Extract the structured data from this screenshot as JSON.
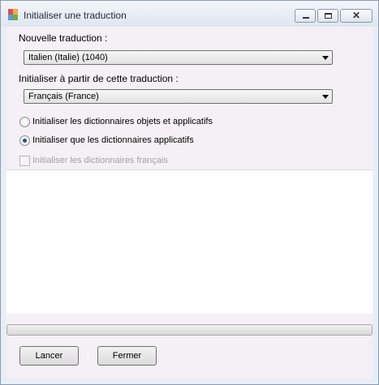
{
  "window": {
    "title": "Initialiser une traduction",
    "icon": "app-grid-icon"
  },
  "form": {
    "new_translation_label": "Nouvelle traduction :",
    "new_translation_value": "Italien (Italie) (1040)",
    "source_translation_label": "Initialiser à partir de cette traduction :",
    "source_translation_value": "Français (France)",
    "options": [
      {
        "label": "Initialiser les dictionnaires objets et applicatifs",
        "selected": false
      },
      {
        "label": "Initialiser que les dictionnaires applicatifs",
        "selected": true
      }
    ],
    "checkbox_label": "Initialiser les dictionnaires français",
    "checkbox_checked": false,
    "checkbox_enabled": false
  },
  "progress": {
    "value": 0
  },
  "buttons": {
    "start": "Lancer",
    "close": "Fermer"
  }
}
